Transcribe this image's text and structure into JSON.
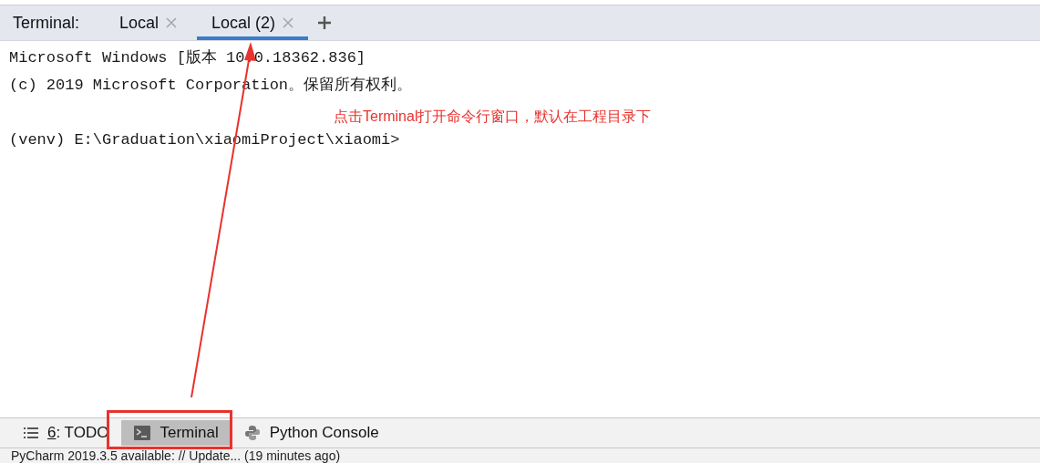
{
  "terminal_panel": {
    "title": "Terminal:",
    "tabs": [
      {
        "label": "Local",
        "selected": false
      },
      {
        "label": "Local (2)",
        "selected": true
      }
    ],
    "lines": [
      "Microsoft Windows [版本 10.0.18362.836]",
      "(c) 2019 Microsoft Corporation。保留所有权利。"
    ],
    "prompt": "(venv) E:\\Graduation\\xiaomiProject\\xiaomi>"
  },
  "annotation": {
    "text": "点击Terminal打开命令行窗口，默认在工程目录下"
  },
  "tool_windows": [
    {
      "kind": "todo",
      "mnemonic": "6",
      "label": ": TODO",
      "selected": false
    },
    {
      "kind": "terminal",
      "label": "Terminal",
      "selected": true
    },
    {
      "kind": "python",
      "label": "Python Console",
      "selected": false
    }
  ],
  "status_bar": {
    "text": "PyCharm 2019.3.5 available: // Update...  (19 minutes ago)"
  }
}
